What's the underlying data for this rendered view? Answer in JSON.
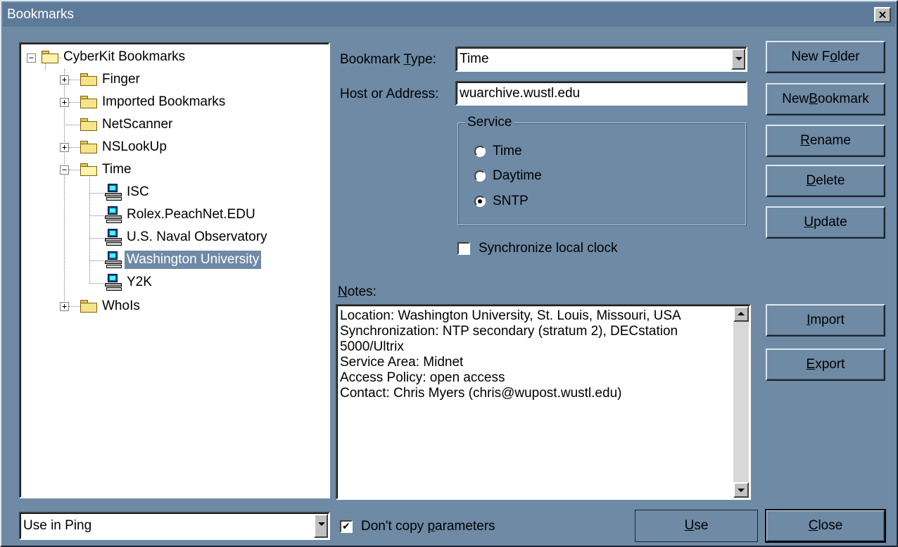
{
  "window": {
    "title": "Bookmarks",
    "close_glyph": "×"
  },
  "tree": {
    "root": "CyberKit Bookmarks",
    "items": [
      {
        "label": "Finger",
        "expander": "+"
      },
      {
        "label": "Imported Bookmarks",
        "expander": "+"
      },
      {
        "label": "NetScanner",
        "expander": ""
      },
      {
        "label": "NSLookUp",
        "expander": "+"
      },
      {
        "label": "Time",
        "expander": "−"
      },
      {
        "label": "ISC"
      },
      {
        "label": "Rolex.PeachNet.EDU"
      },
      {
        "label": "U.S. Naval Observatory"
      },
      {
        "label": "Washington University",
        "selected": true
      },
      {
        "label": "Y2K"
      },
      {
        "label": "WhoIs",
        "expander": "+"
      }
    ]
  },
  "form": {
    "bookmark_type_label_pre": "Bookmark ",
    "bookmark_type_label_u": "T",
    "bookmark_type_label_post": "ype:",
    "bookmark_type_value": "Time",
    "host_label": "Host or Address:",
    "host_value": "wuarchive.wustl.edu",
    "service_title": "Service",
    "service_options": [
      "Time",
      "Daytime",
      "SNTP"
    ],
    "service_selected": "SNTP",
    "sync_label": "Synchronize local clock",
    "notes_label_u": "N",
    "notes_label_rest": "otes:",
    "notes_lines": [
      "Location: Washington University, St. Louis, Missouri, USA",
      "Synchronization: NTP secondary (stratum 2), DECstation",
      "5000/Ultrix",
      "Service Area: Midnet",
      "Access Policy: open access",
      "Contact: Chris Myers (chris@wupost.wustl.edu)"
    ]
  },
  "buttons": {
    "new_folder": {
      "pre": "New F",
      "u": "o",
      "post": "lder"
    },
    "new_bookmark": {
      "pre": "New ",
      "u": "B",
      "post": "ookmark"
    },
    "rename": {
      "pre": "",
      "u": "R",
      "post": "ename"
    },
    "delete": {
      "pre": "",
      "u": "D",
      "post": "elete"
    },
    "update": {
      "pre": "",
      "u": "U",
      "post": "pdate"
    },
    "import": {
      "pre": "",
      "u": "I",
      "post": "mport"
    },
    "export": {
      "pre": "",
      "u": "E",
      "post": "xport"
    },
    "use": {
      "pre": "",
      "u": "U",
      "post": "se"
    },
    "close": {
      "pre": "",
      "u": "C",
      "post": "lose"
    }
  },
  "footer": {
    "use_in_value": "Use in Ping",
    "dont_copy_pre": "Don't copy ",
    "dont_copy_u": "p",
    "dont_copy_post": "arameters",
    "check_glyph": "✔"
  },
  "colors": {
    "dialog_bg": "#6e8aa5",
    "titlebar_bg": "#5d7a98",
    "selection_bg": "#6e8aa5"
  }
}
